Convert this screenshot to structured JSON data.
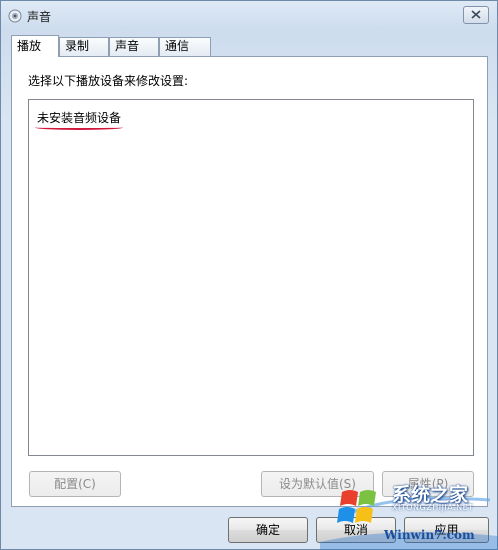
{
  "window": {
    "title": "声音"
  },
  "tabs": [
    {
      "label": "播放",
      "active": true
    },
    {
      "label": "录制",
      "active": false
    },
    {
      "label": "声音",
      "active": false
    },
    {
      "label": "通信",
      "active": false
    }
  ],
  "playback": {
    "instruction": "选择以下播放设备来修改设置:",
    "empty_message": "未安装音频设备"
  },
  "buttons": {
    "configure": "配置(C)",
    "set_default": "设为默认值(S)",
    "properties": "属性(P)",
    "ok": "确定",
    "cancel": "取消",
    "apply": "应用"
  },
  "watermark": {
    "brand": "系统之家",
    "url": "XITONGZHIJIA.NET",
    "site": "Winwin7.com"
  },
  "colors": {
    "underline": "#d0183c",
    "titlebar": "#cddcee"
  }
}
